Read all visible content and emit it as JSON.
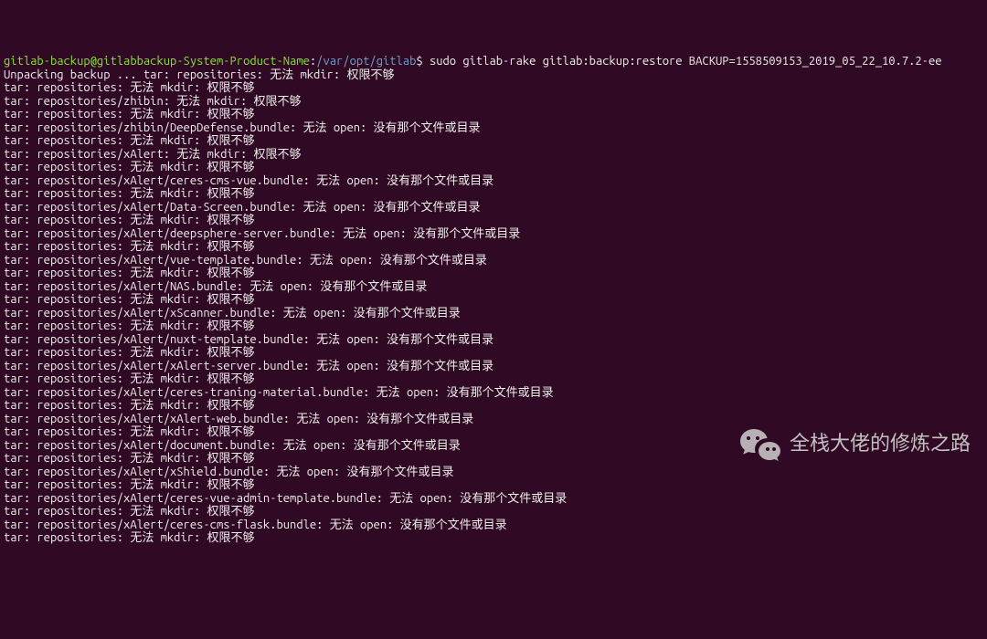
{
  "prompt": {
    "user_host": "gitlab-backup@gitlabbackup-System-Product-Name",
    "colon": ":",
    "path": "/var/opt/gitlab",
    "dollar": "$ ",
    "command": "sudo gitlab-rake gitlab:backup:restore BACKUP=1558509153_2019_05_22_10.7.2-ee"
  },
  "lines": [
    "Unpacking backup ... tar: repositories: 无法 mkdir: 权限不够",
    "tar: repositories: 无法 mkdir: 权限不够",
    "tar: repositories/zhibin: 无法 mkdir: 权限不够",
    "tar: repositories: 无法 mkdir: 权限不够",
    "tar: repositories/zhibin/DeepDefense.bundle: 无法 open: 没有那个文件或目录",
    "tar: repositories: 无法 mkdir: 权限不够",
    "tar: repositories/xAlert: 无法 mkdir: 权限不够",
    "tar: repositories: 无法 mkdir: 权限不够",
    "tar: repositories/xAlert/ceres-cms-vue.bundle: 无法 open: 没有那个文件或目录",
    "tar: repositories: 无法 mkdir: 权限不够",
    "tar: repositories/xAlert/Data-Screen.bundle: 无法 open: 没有那个文件或目录",
    "tar: repositories: 无法 mkdir: 权限不够",
    "tar: repositories/xAlert/deepsphere-server.bundle: 无法 open: 没有那个文件或目录",
    "tar: repositories: 无法 mkdir: 权限不够",
    "tar: repositories/xAlert/vue-template.bundle: 无法 open: 没有那个文件或目录",
    "tar: repositories: 无法 mkdir: 权限不够",
    "tar: repositories/xAlert/NAS.bundle: 无法 open: 没有那个文件或目录",
    "tar: repositories: 无法 mkdir: 权限不够",
    "tar: repositories/xAlert/xScanner.bundle: 无法 open: 没有那个文件或目录",
    "tar: repositories: 无法 mkdir: 权限不够",
    "tar: repositories/xAlert/nuxt-template.bundle: 无法 open: 没有那个文件或目录",
    "tar: repositories: 无法 mkdir: 权限不够",
    "tar: repositories/xAlert/xAlert-server.bundle: 无法 open: 没有那个文件或目录",
    "tar: repositories: 无法 mkdir: 权限不够",
    "tar: repositories/xAlert/ceres-traning-material.bundle: 无法 open: 没有那个文件或目录",
    "tar: repositories: 无法 mkdir: 权限不够",
    "tar: repositories/xAlert/xAlert-web.bundle: 无法 open: 没有那个文件或目录",
    "tar: repositories: 无法 mkdir: 权限不够",
    "tar: repositories/xAlert/document.bundle: 无法 open: 没有那个文件或目录",
    "tar: repositories: 无法 mkdir: 权限不够",
    "tar: repositories/xAlert/xShield.bundle: 无法 open: 没有那个文件或目录",
    "tar: repositories: 无法 mkdir: 权限不够",
    "tar: repositories/xAlert/ceres-vue-admin-template.bundle: 无法 open: 没有那个文件或目录",
    "tar: repositories: 无法 mkdir: 权限不够",
    "tar: repositories/xAlert/ceres-cms-flask.bundle: 无法 open: 没有那个文件或目录",
    "tar: repositories: 无法 mkdir: 权限不够"
  ],
  "watermark": {
    "text": "全栈大佬的修炼之路",
    "icon": "wechat-icon"
  }
}
